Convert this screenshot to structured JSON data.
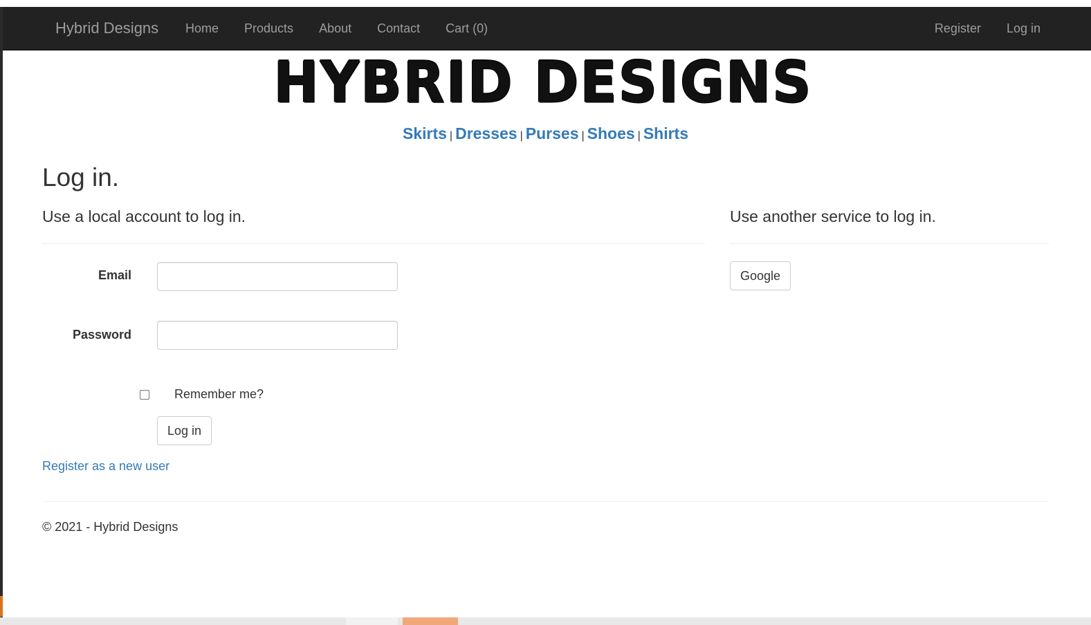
{
  "navbar": {
    "brand": "Hybrid Designs",
    "links": [
      {
        "label": "Home"
      },
      {
        "label": "Products"
      },
      {
        "label": "About"
      },
      {
        "label": "Contact"
      },
      {
        "label": "Cart (0)"
      }
    ],
    "right_links": [
      {
        "label": "Register"
      },
      {
        "label": "Log in"
      }
    ]
  },
  "logo": {
    "text": "HYBRID DESIGNS"
  },
  "categories": [
    {
      "label": "Skirts"
    },
    {
      "label": "Dresses"
    },
    {
      "label": "Purses"
    },
    {
      "label": "Shoes"
    },
    {
      "label": "Shirts"
    }
  ],
  "category_separator": "|",
  "page": {
    "title": "Log in."
  },
  "local_login": {
    "heading": "Use a local account to log in.",
    "email_label": "Email",
    "email_value": "",
    "password_label": "Password",
    "password_value": "",
    "remember_label": "Remember me?",
    "remember_checked": false,
    "submit_label": "Log in",
    "register_link": "Register as a new user"
  },
  "external_login": {
    "heading": "Use another service to log in.",
    "providers": [
      {
        "label": "Google"
      }
    ]
  },
  "footer": {
    "text": "© 2021 - Hybrid Designs"
  },
  "colors": {
    "navbar_bg": "#222222",
    "nav_text": "#9d9d9d",
    "link": "#337ab7",
    "text": "#333333"
  }
}
